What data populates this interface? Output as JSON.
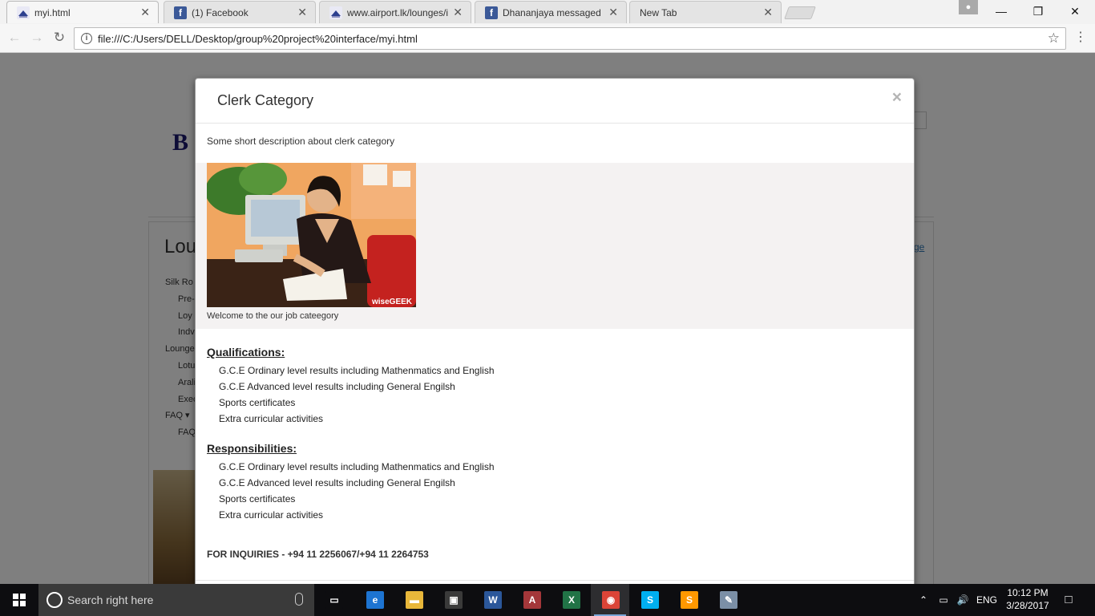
{
  "browser": {
    "tabs": [
      {
        "label": "myi.html",
        "favicon": "airport-favicon",
        "active": true
      },
      {
        "label": "(1) Facebook",
        "favicon": "facebook-favicon",
        "active": false
      },
      {
        "label": "www.airport.lk/lounges/i",
        "favicon": "airport-favicon",
        "active": false
      },
      {
        "label": "Dhananjaya messaged yo",
        "favicon": "facebook-favicon",
        "active": false
      },
      {
        "label": "New Tab",
        "favicon": "",
        "active": false
      }
    ],
    "tab_close_glyph": "✕",
    "url": "file:///C:/Users/DELL/Desktop/group%20project%20interface/myi.html",
    "window_controls": {
      "minimize": "—",
      "restore": "❐",
      "close": "✕"
    }
  },
  "background_page": {
    "logo_text": "B",
    "heading": "Lou",
    "side_link": "ge",
    "menu_items": [
      {
        "label": "Silk Ro",
        "sub": false
      },
      {
        "label": "Pre-",
        "sub": true
      },
      {
        "label": "Loy",
        "sub": true
      },
      {
        "label": "Indv",
        "sub": true
      },
      {
        "label": "Lounge",
        "sub": false
      },
      {
        "label": "Lotu",
        "sub": true
      },
      {
        "label": "Arali",
        "sub": true
      },
      {
        "label": "Exec",
        "sub": true
      },
      {
        "label": "FAQ ▾",
        "sub": false
      },
      {
        "label": "FAQ",
        "sub": true
      }
    ]
  },
  "modal": {
    "title": "Clerk Category",
    "close_glyph": "×",
    "description": "Some short description about clerk category",
    "image_watermark": "wiseGEEK",
    "image_caption": "Welcome to the our job cateegory",
    "qualifications": {
      "title": "Qualifications:",
      "items": [
        "G.C.E Ordinary level results including Mathenmatics and English",
        "G.C.E Advanced level results including General Engilsh",
        "Sports certificates",
        "Extra curricular activities"
      ]
    },
    "responsibilities": {
      "title": "Responsibilities:",
      "items": [
        "G.C.E Ordinary level results including Mathenmatics and English",
        "G.C.E Advanced level results including General Engilsh",
        "Sports certificates",
        "Extra curricular activities"
      ]
    },
    "inquiries": "FOR INQUIRIES - +94 11 2256067/+94 11 2264753"
  },
  "taskbar": {
    "search_placeholder": "Search right here",
    "apps": [
      {
        "name": "task-view",
        "glyph": "▭",
        "color": "#0d0d10"
      },
      {
        "name": "edge",
        "glyph": "e",
        "color": "#1d74d2"
      },
      {
        "name": "file-explorer",
        "glyph": "▬",
        "color": "#e8b73a"
      },
      {
        "name": "store",
        "glyph": "▣",
        "color": "#3a3a3a"
      },
      {
        "name": "word",
        "glyph": "W",
        "color": "#2b579a"
      },
      {
        "name": "access",
        "glyph": "A",
        "color": "#a4373a"
      },
      {
        "name": "excel",
        "glyph": "X",
        "color": "#217346"
      },
      {
        "name": "chrome",
        "glyph": "◉",
        "color": "#db4437"
      },
      {
        "name": "skype",
        "glyph": "S",
        "color": "#00aff0"
      },
      {
        "name": "sublime",
        "glyph": "S",
        "color": "#ff9800"
      },
      {
        "name": "paint",
        "glyph": "✎",
        "color": "#7b8fa6"
      }
    ],
    "language": "ENG",
    "time": "10:12 PM",
    "date": "3/28/2017"
  }
}
